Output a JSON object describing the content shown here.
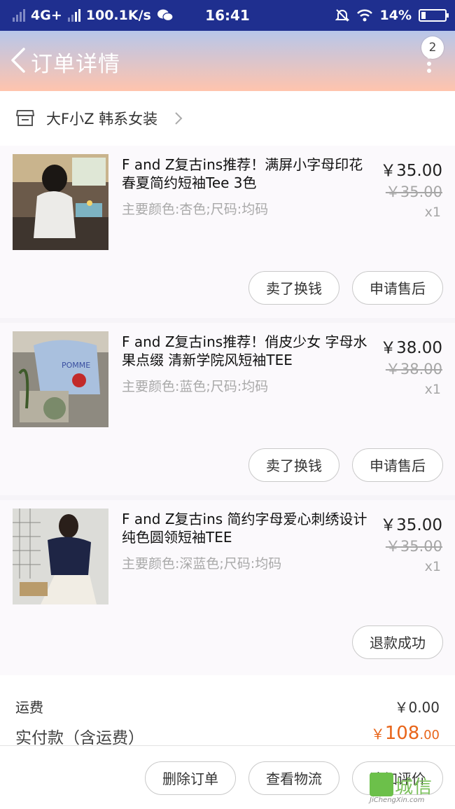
{
  "status_bar": {
    "network": "4G+",
    "speed": "100.1K/s",
    "time": "16:41",
    "battery": "14%"
  },
  "header": {
    "title": "订单详情",
    "badge_count": "2"
  },
  "shop": {
    "name": "大F小Z 韩系女装"
  },
  "items": [
    {
      "name": "F and Z复古ins推荐！满屏小字母印花春夏简约短袖Tee 3色",
      "spec": "主要颜色:杏色;尺码:均码",
      "price": "￥35.00",
      "original_price": "￥35.00",
      "quantity": "x1",
      "buttons": [
        "卖了换钱",
        "申请售后"
      ]
    },
    {
      "name": "F and Z复古ins推荐！俏皮少女 字母水果点缀 清新学院风短袖TEE",
      "spec": "主要颜色:蓝色;尺码:均码",
      "price": "￥38.00",
      "original_price": "￥38.00",
      "quantity": "x1",
      "buttons": [
        "卖了换钱",
        "申请售后"
      ]
    },
    {
      "name": "F and Z复古ins  简约字母爱心刺绣设计 纯色圆领短袖TEE",
      "spec": "主要颜色:深蓝色;尺码:均码",
      "price": "￥35.00",
      "original_price": "￥35.00",
      "quantity": "x1",
      "buttons": [
        "退款成功"
      ]
    }
  ],
  "totals": {
    "shipping_label": "运费",
    "shipping_value": "￥0.00",
    "paid_label": "实付款（含运费）",
    "paid_currency": "￥",
    "paid_int": "108",
    "paid_dec": ".00"
  },
  "footer": {
    "buttons": [
      "删除订单",
      "查看物流",
      "追加评价"
    ]
  },
  "watermark": {
    "cn": "城信",
    "en": "JiChengXin.com"
  },
  "colors": {
    "status_bar": "#1f2f8f",
    "header_top": "#b7c6ea",
    "header_bottom": "#ffc4ad",
    "price_accent": "#e8651a"
  }
}
